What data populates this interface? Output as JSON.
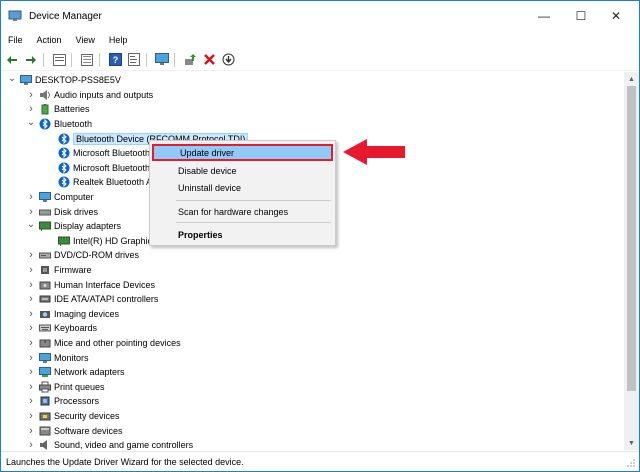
{
  "window": {
    "title": "Device Manager"
  },
  "window_controls": {
    "minimize": "—",
    "maximize": "☐",
    "close": "✕"
  },
  "menu": [
    "File",
    "Action",
    "View",
    "Help"
  ],
  "toolbar": {
    "icons": [
      "back-arrow-icon",
      "forward-arrow-icon",
      "properties-icon",
      "tree-view-icon",
      "help-icon",
      "details-icon",
      "monitor-icon",
      "update-driver-icon",
      "uninstall-icon",
      "scan-download-icon"
    ]
  },
  "tree": {
    "root": "DESKTOP-PSS8E5V",
    "items": [
      {
        "label": "Audio inputs and outputs",
        "level": 1,
        "expand": "collapsed",
        "icon": "speaker-icon"
      },
      {
        "label": "Batteries",
        "level": 1,
        "expand": "collapsed",
        "icon": "battery-icon"
      },
      {
        "label": "Bluetooth",
        "level": 1,
        "expand": "expanded",
        "icon": "bluetooth-icon"
      },
      {
        "label": "Bluetooth Device (RFCOMM Protocol TDI)",
        "level": 2,
        "expand": "none",
        "icon": "bluetooth-icon",
        "selected": true
      },
      {
        "label": "Microsoft Bluetooth Enumerator",
        "level": 2,
        "expand": "none",
        "icon": "bluetooth-icon"
      },
      {
        "label": "Microsoft Bluetooth LE Enumerator",
        "level": 2,
        "expand": "none",
        "icon": "bluetooth-icon"
      },
      {
        "label": "Realtek Bluetooth Adapter",
        "level": 2,
        "expand": "none",
        "icon": "bluetooth-icon"
      },
      {
        "label": "Computer",
        "level": 1,
        "expand": "collapsed",
        "icon": "computer-icon"
      },
      {
        "label": "Disk drives",
        "level": 1,
        "expand": "collapsed",
        "icon": "disk-icon"
      },
      {
        "label": "Display adapters",
        "level": 1,
        "expand": "expanded",
        "icon": "display-icon"
      },
      {
        "label": "Intel(R) HD Graphics",
        "level": 2,
        "expand": "none",
        "icon": "display-icon"
      },
      {
        "label": "DVD/CD-ROM drives",
        "level": 1,
        "expand": "collapsed",
        "icon": "dvd-icon"
      },
      {
        "label": "Firmware",
        "level": 1,
        "expand": "collapsed",
        "icon": "chip-icon"
      },
      {
        "label": "Human Interface Devices",
        "level": 1,
        "expand": "collapsed",
        "icon": "hid-icon"
      },
      {
        "label": "IDE ATA/ATAPI controllers",
        "level": 1,
        "expand": "collapsed",
        "icon": "controller-icon"
      },
      {
        "label": "Imaging devices",
        "level": 1,
        "expand": "collapsed",
        "icon": "camera-icon"
      },
      {
        "label": "Keyboards",
        "level": 1,
        "expand": "collapsed",
        "icon": "keyboard-icon"
      },
      {
        "label": "Mice and other pointing devices",
        "level": 1,
        "expand": "collapsed",
        "icon": "mouse-icon"
      },
      {
        "label": "Monitors",
        "level": 1,
        "expand": "collapsed",
        "icon": "monitor-icon"
      },
      {
        "label": "Network adapters",
        "level": 1,
        "expand": "collapsed",
        "icon": "network-icon"
      },
      {
        "label": "Print queues",
        "level": 1,
        "expand": "collapsed",
        "icon": "printer-icon"
      },
      {
        "label": "Processors",
        "level": 1,
        "expand": "collapsed",
        "icon": "processor-icon"
      },
      {
        "label": "Security devices",
        "level": 1,
        "expand": "collapsed",
        "icon": "security-icon"
      },
      {
        "label": "Software devices",
        "level": 1,
        "expand": "collapsed",
        "icon": "software-icon"
      },
      {
        "label": "Sound, video and game controllers",
        "level": 1,
        "expand": "collapsed",
        "icon": "sound-icon"
      }
    ]
  },
  "context_menu": {
    "items": [
      {
        "label": "Update driver",
        "highlighted": true
      },
      {
        "label": "Disable device"
      },
      {
        "label": "Uninstall device"
      },
      {
        "label": "Scan for hardware changes"
      },
      {
        "label": "Properties",
        "bold": true
      }
    ]
  },
  "status": {
    "text": "Launches the Update Driver Wizard for the selected device."
  },
  "colors": {
    "accent": "#1e7fd6",
    "highlight": "#91c9f7",
    "annotation_red": "#e8192c",
    "bluetooth": "#0a64c8"
  }
}
